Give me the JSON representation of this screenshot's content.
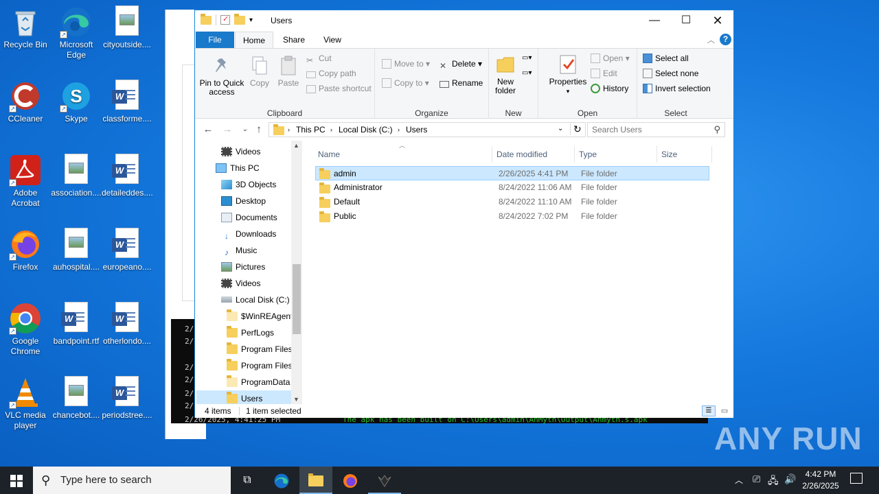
{
  "desktop": {
    "icons": [
      {
        "label": "Recycle Bin"
      },
      {
        "label": "Microsoft Edge"
      },
      {
        "label": "cityoutside...."
      },
      {
        "label": "CCleaner"
      },
      {
        "label": "Skype"
      },
      {
        "label": "classforme...."
      },
      {
        "label": "Adobe Acrobat"
      },
      {
        "label": "association...."
      },
      {
        "label": "detaileddes...."
      },
      {
        "label": "Firefox"
      },
      {
        "label": "auhospital...."
      },
      {
        "label": "europeano...."
      },
      {
        "label": "Google Chrome"
      },
      {
        "label": "bandpoint.rtf"
      },
      {
        "label": "otherlondo...."
      },
      {
        "label": "VLC media player"
      },
      {
        "label": "chancebot...."
      },
      {
        "label": "periodstree...."
      }
    ]
  },
  "console": {
    "lines": [
      "2/",
      "2/",
      "2/",
      "2/",
      "2/",
      "2/"
    ],
    "last_line": "2/26/2025, 4:41:25 PM",
    "message": "The apk has been built on C:\\Users\\admin\\AhMyth\\Output\\Ahmyth.s.apk"
  },
  "explorer": {
    "title": "Users",
    "tabs": {
      "file": "File",
      "home": "Home",
      "share": "Share",
      "view": "View"
    },
    "ribbon": {
      "clipboard": {
        "label": "Clipboard",
        "pin": "Pin to Quick access",
        "copy": "Copy",
        "paste": "Paste",
        "cut": "Cut",
        "copy_path": "Copy path",
        "paste_shortcut": "Paste shortcut"
      },
      "organize": {
        "label": "Organize",
        "move_to": "Move to",
        "copy_to": "Copy to",
        "delete": "Delete",
        "rename": "Rename"
      },
      "new": {
        "label": "New",
        "new_folder": "New folder"
      },
      "open": {
        "label": "Open",
        "properties": "Properties",
        "open": "Open",
        "edit": "Edit",
        "history": "History"
      },
      "select": {
        "label": "Select",
        "select_all": "Select all",
        "select_none": "Select none",
        "invert": "Invert selection"
      }
    },
    "address": {
      "crumbs": [
        "This PC",
        "Local Disk (C:)",
        "Users"
      ],
      "search_placeholder": "Search Users"
    },
    "nav": [
      {
        "label": "Videos",
        "icon": "video-icon"
      },
      {
        "label": "This PC",
        "icon": "pc-icon"
      },
      {
        "label": "3D Objects",
        "icon": "cube-icon"
      },
      {
        "label": "Desktop",
        "icon": "desktop-icon"
      },
      {
        "label": "Documents",
        "icon": "documents-icon"
      },
      {
        "label": "Downloads",
        "icon": "download-icon"
      },
      {
        "label": "Music",
        "icon": "music-icon"
      },
      {
        "label": "Pictures",
        "icon": "pictures-icon"
      },
      {
        "label": "Videos",
        "icon": "video-icon"
      },
      {
        "label": "Local Disk (C:)",
        "icon": "drive-icon"
      },
      {
        "label": "$WinREAgent",
        "icon": "folder-icon"
      },
      {
        "label": "PerfLogs",
        "icon": "folder-icon"
      },
      {
        "label": "Program Files",
        "icon": "folder-icon"
      },
      {
        "label": "Program Files",
        "icon": "folder-icon"
      },
      {
        "label": "ProgramData",
        "icon": "folder-icon"
      },
      {
        "label": "Users",
        "icon": "folder-icon"
      }
    ],
    "columns": {
      "name": "Name",
      "date": "Date modified",
      "type": "Type",
      "size": "Size"
    },
    "files": [
      {
        "name": "admin",
        "date": "2/26/2025 4:41 PM",
        "type": "File folder",
        "size": ""
      },
      {
        "name": "Administrator",
        "date": "8/24/2022 11:06 AM",
        "type": "File folder",
        "size": ""
      },
      {
        "name": "Default",
        "date": "8/24/2022 11:10 AM",
        "type": "File folder",
        "size": ""
      },
      {
        "name": "Public",
        "date": "8/24/2022 7:02 PM",
        "type": "File folder",
        "size": ""
      }
    ],
    "status": {
      "items": "4 items",
      "selected": "1 item selected"
    }
  },
  "taskbar": {
    "search_placeholder": "Type here to search",
    "time": "4:42 PM",
    "date": "2/26/2025"
  },
  "watermark": "ANY RUN",
  "colors": {
    "accent": "#1979ca",
    "selection": "#cce8ff",
    "folder": "#f6cf5c"
  }
}
